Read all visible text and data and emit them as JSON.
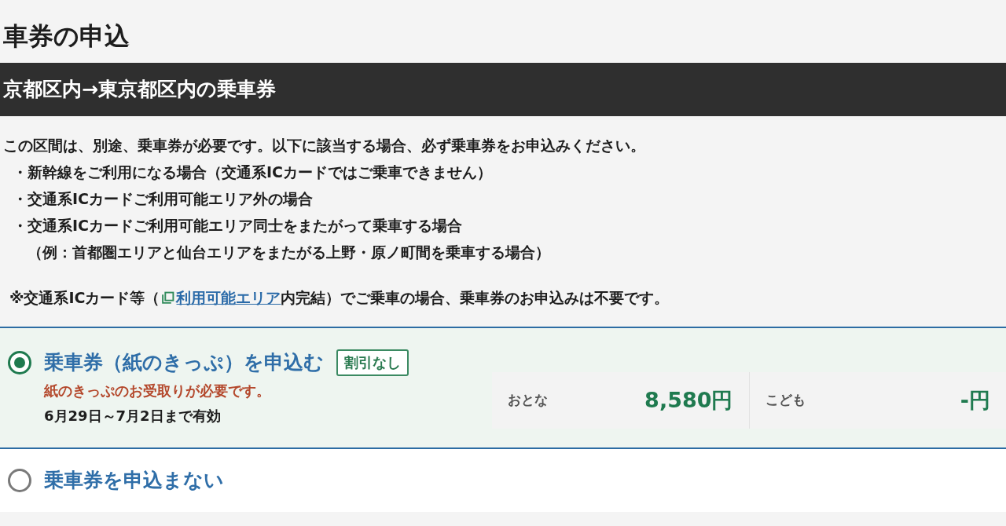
{
  "page": {
    "title": "車券の申込"
  },
  "section": {
    "heading": "京都区内→東京都区内の乗車券",
    "intro": "この区間は、別途、乗車券が必要です。以下に該当する場合、必ず乗車券をお申込みください。",
    "conditions": [
      {
        "text": "・新幹線をご利用になる場合（交通系ICカードではご乗車できません）"
      },
      {
        "text": "・交通系ICカードご利用可能エリア外の場合"
      },
      {
        "text": "・交通系ICカードご利用可能エリア同士をまたがって乗車する場合",
        "note": "（例：首都圏エリアと仙台エリアをまたがる上野・原ノ町間を乗車する場合）"
      }
    ],
    "ic_note": {
      "before": "※交通系ICカード等（",
      "link": "利用可能エリア",
      "after": "内完結）でご乗車の場合、乗車券のお申込みは不要です。"
    }
  },
  "options": [
    {
      "selected": true,
      "label": "乗車券（紙のきっぷ）を申込む",
      "badge": "割引なし",
      "notice": "紙のきっぷのお受取りが必要です。",
      "validity": "6月29日～7月2日まで有効",
      "prices": [
        {
          "label": "おとな",
          "amount": "8,580円"
        },
        {
          "label": "こども",
          "amount": "-円"
        }
      ]
    },
    {
      "selected": false,
      "label": "乗車券を申込まない"
    }
  ]
}
